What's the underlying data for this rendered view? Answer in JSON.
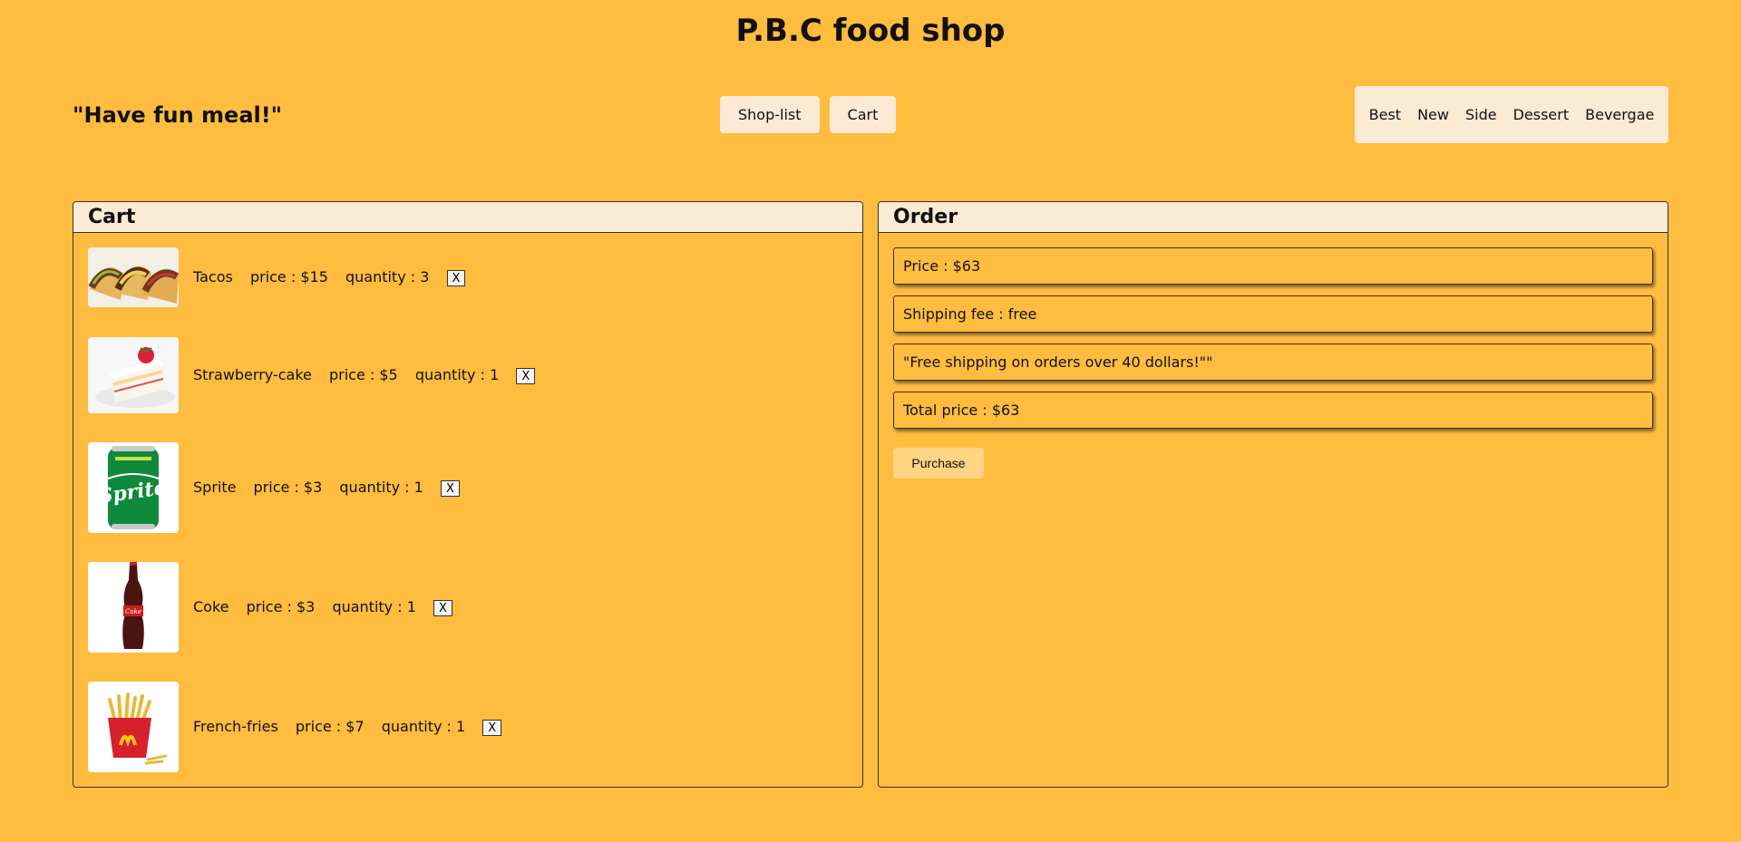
{
  "header": {
    "title": "P.B.C food shop",
    "slogan": "\"Have fun meal!\""
  },
  "nav": {
    "shop_list": "Shop-list",
    "cart": "Cart"
  },
  "categories": [
    "Best",
    "New",
    "Side",
    "Dessert",
    "Bevergae"
  ],
  "cart": {
    "title": "Cart",
    "items": [
      {
        "name": "Tacos",
        "price": "price : $15",
        "quantity": "quantity : 3",
        "remove": "X",
        "image": "tacos-image"
      },
      {
        "name": "Strawberry-cake",
        "price": "price : $5",
        "quantity": "quantity : 1",
        "remove": "X",
        "image": "strawberry-cake-image"
      },
      {
        "name": "Sprite",
        "price": "price : $3",
        "quantity": "quantity : 1",
        "remove": "X",
        "image": "sprite-can-image"
      },
      {
        "name": "Coke",
        "price": "price : $3",
        "quantity": "quantity : 1",
        "remove": "X",
        "image": "coke-bottle-image"
      },
      {
        "name": "French-fries",
        "price": "price : $7",
        "quantity": "quantity : 1",
        "remove": "X",
        "image": "french-fries-image"
      }
    ]
  },
  "order": {
    "title": "Order",
    "price": "Price : $63",
    "shipping_fee": "Shipping fee : free",
    "shipping_note": "\"Free shipping on orders over 40 dollars!\"\"",
    "total_price": "Total price : $63",
    "purchase": "Purchase"
  },
  "colors": {
    "background": "#FFBC3F",
    "panel_header": "#FBEAD4",
    "purchase_button": "#FFD482"
  }
}
